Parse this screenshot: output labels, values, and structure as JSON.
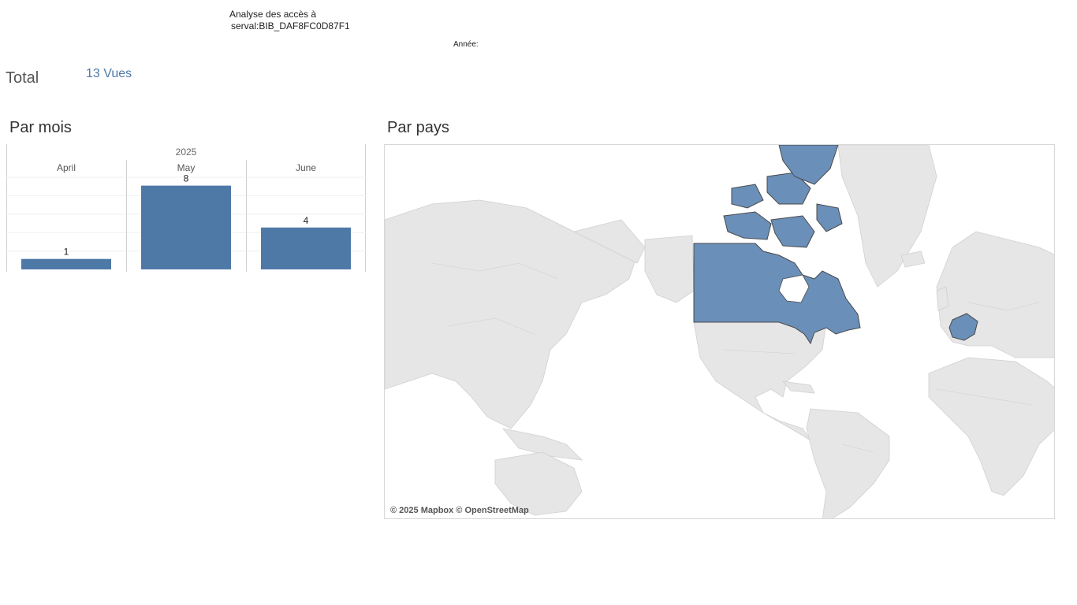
{
  "header": {
    "title_line1": "Analyse des accès à",
    "title_line2": "serval:BIB_DAF8FC0D87F1",
    "year_filter_label": "Année:"
  },
  "total": {
    "label": "Total",
    "value": "13 Vues"
  },
  "bar_section": {
    "title": "Par mois"
  },
  "map_section": {
    "title": "Par pays",
    "attribution": "© 2025 Mapbox © OpenStreetMap",
    "highlighted_countries": [
      "Canada",
      "France"
    ],
    "highlight_color": "#4e79a7"
  },
  "chart_data": {
    "type": "bar",
    "group_label": "2025",
    "categories": [
      "April",
      "May",
      "June"
    ],
    "values": [
      1,
      8,
      4
    ],
    "ylim": [
      0,
      8.8
    ],
    "grid": true,
    "bar_color": "#4e79a7"
  }
}
